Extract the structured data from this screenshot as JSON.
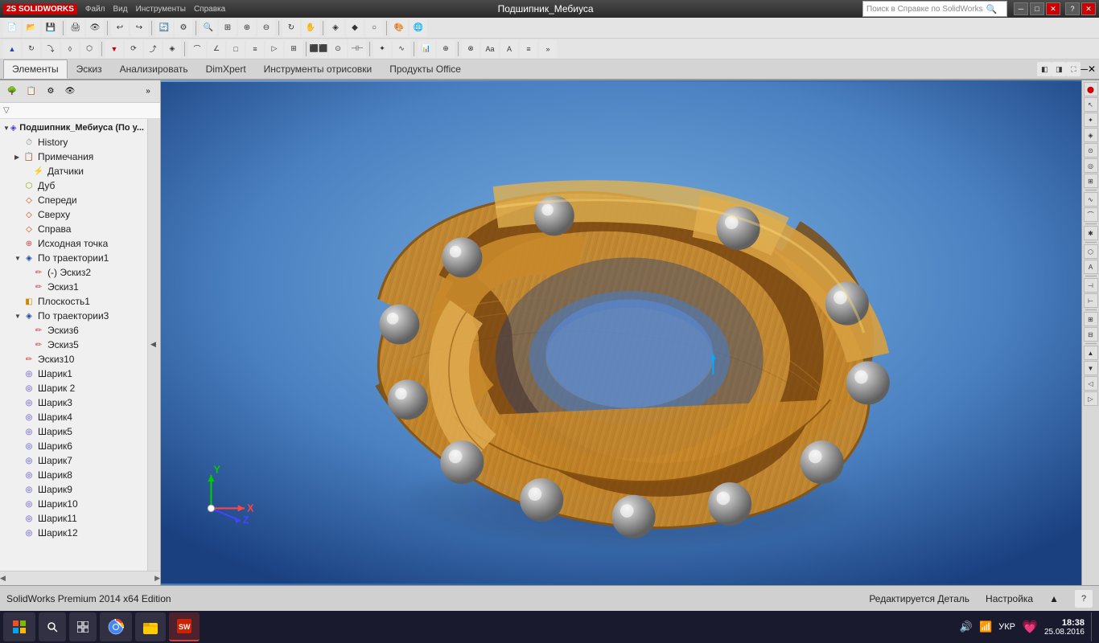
{
  "titlebar": {
    "logo": "2S SOLIDWORKS",
    "title": "Подшипник_Мебиуса",
    "search_placeholder": "Поиск в Справке по SolidWorks",
    "minimize_label": "─",
    "restore_label": "□",
    "close_label": "✕"
  },
  "toolbar1": {
    "buttons": [
      "↩",
      "↪",
      "▶",
      "⬛",
      "🔲",
      "✦",
      "⬛",
      "⬛",
      "⬛",
      "⬛"
    ]
  },
  "menu_tabs": [
    {
      "label": "Элементы",
      "active": true
    },
    {
      "label": "Эскиз",
      "active": false
    },
    {
      "label": "Анализировать",
      "active": false
    },
    {
      "label": "DimXpert",
      "active": false
    },
    {
      "label": "Инструменты отрисовки",
      "active": false
    },
    {
      "label": "Продукты Office",
      "active": false
    }
  ],
  "feature_tree": {
    "root_label": "Подшипник_Мебиуса  (По у...",
    "items": [
      {
        "id": "history",
        "label": "History",
        "indent": 1,
        "expanded": false,
        "icon": "history",
        "has_children": false
      },
      {
        "id": "notes",
        "label": "Примечания",
        "indent": 1,
        "expanded": false,
        "icon": "notes",
        "has_children": true
      },
      {
        "id": "sensors",
        "label": "Датчики",
        "indent": 2,
        "expanded": false,
        "icon": "sensor",
        "has_children": false
      },
      {
        "id": "material",
        "label": "Дуб",
        "indent": 1,
        "expanded": false,
        "icon": "material",
        "has_children": false
      },
      {
        "id": "front",
        "label": "Спереди",
        "indent": 1,
        "expanded": false,
        "icon": "plane",
        "has_children": false
      },
      {
        "id": "top",
        "label": "Сверху",
        "indent": 1,
        "expanded": false,
        "icon": "plane",
        "has_children": false
      },
      {
        "id": "right",
        "label": "Справа",
        "indent": 1,
        "expanded": false,
        "icon": "plane",
        "has_children": false
      },
      {
        "id": "origin",
        "label": "Исходная точка",
        "indent": 1,
        "expanded": false,
        "icon": "origin",
        "has_children": false
      },
      {
        "id": "sweep1",
        "label": "По траектории1",
        "indent": 1,
        "expanded": true,
        "icon": "sweep",
        "has_children": true
      },
      {
        "id": "sketch2",
        "label": "(-) Эскиз2",
        "indent": 2,
        "expanded": false,
        "icon": "sketch",
        "has_children": false
      },
      {
        "id": "sketch1",
        "label": "Эскиз1",
        "indent": 2,
        "expanded": false,
        "icon": "sketch",
        "has_children": false
      },
      {
        "id": "plane1",
        "label": "Плоскость1",
        "indent": 1,
        "expanded": false,
        "icon": "plane",
        "has_children": false
      },
      {
        "id": "sweep3",
        "label": "По траектории3",
        "indent": 1,
        "expanded": true,
        "icon": "sweep",
        "has_children": true
      },
      {
        "id": "sketch6",
        "label": "Эскиз6",
        "indent": 2,
        "expanded": false,
        "icon": "sketch",
        "has_children": false
      },
      {
        "id": "sketch5",
        "label": "Эскиз5",
        "indent": 2,
        "expanded": false,
        "icon": "sketch",
        "has_children": false
      },
      {
        "id": "sketch10",
        "label": "Эскиз10",
        "indent": 1,
        "expanded": false,
        "icon": "sketch",
        "has_children": false
      },
      {
        "id": "ball1",
        "label": "Шарик1",
        "indent": 1,
        "expanded": false,
        "icon": "ball",
        "has_children": false
      },
      {
        "id": "ball2",
        "label": "Шарик 2",
        "indent": 1,
        "expanded": false,
        "icon": "ball",
        "has_children": false
      },
      {
        "id": "ball3",
        "label": "Шарик3",
        "indent": 1,
        "expanded": false,
        "icon": "ball",
        "has_children": false
      },
      {
        "id": "ball4",
        "label": "Шарик4",
        "indent": 1,
        "expanded": false,
        "icon": "ball",
        "has_children": false
      },
      {
        "id": "ball5",
        "label": "Шарик5",
        "indent": 1,
        "expanded": false,
        "icon": "ball",
        "has_children": false
      },
      {
        "id": "ball6",
        "label": "Шарик6",
        "indent": 1,
        "expanded": false,
        "icon": "ball",
        "has_children": false
      },
      {
        "id": "ball7",
        "label": "Шарик7",
        "indent": 1,
        "expanded": false,
        "icon": "ball",
        "has_children": false
      },
      {
        "id": "ball8",
        "label": "Шарик8",
        "indent": 1,
        "expanded": false,
        "icon": "ball",
        "has_children": false
      },
      {
        "id": "ball9",
        "label": "Шарик9",
        "indent": 1,
        "expanded": false,
        "icon": "ball",
        "has_children": false
      },
      {
        "id": "ball10",
        "label": "Шарик10",
        "indent": 1,
        "expanded": false,
        "icon": "ball",
        "has_children": false
      },
      {
        "id": "ball11",
        "label": "Шарик11",
        "indent": 1,
        "expanded": false,
        "icon": "ball",
        "has_children": false
      },
      {
        "id": "ball12",
        "label": "Шарик12",
        "indent": 1,
        "expanded": false,
        "icon": "ball",
        "has_children": false
      }
    ]
  },
  "statusbar": {
    "left_text": "SolidWorks Premium 2014 x64 Edition",
    "center_text": "Редактируется Деталь",
    "right_text": "Настройка",
    "arrow": "▲"
  },
  "taskbar": {
    "start_icon": "⊞",
    "search_icon": "🔍",
    "task_view_icon": "⬜",
    "browser_label": "🌐",
    "explorer_label": "📁",
    "solidworks_label": "SW",
    "time": "18:38",
    "date": "25.08.2016",
    "lang": "УКР",
    "network_icon": "🔊",
    "volume_icon": "🔊"
  },
  "right_toolbar": {
    "buttons": [
      "↑",
      "↓",
      "←",
      "→",
      "⊕",
      "⊗",
      "◈",
      "⊞",
      "⊟",
      "△",
      "▽",
      "◁",
      "▷",
      "✦",
      "★",
      "◆",
      "●",
      "○",
      "□",
      "■",
      "▲",
      "▼",
      "≡",
      "≈",
      "∞",
      "⊂",
      "⊃",
      "∩",
      "∪",
      "⊥"
    ]
  },
  "colors": {
    "background_gradient_start": "#6a9fd8",
    "background_gradient_end": "#1a4080",
    "wood_color": "#c8882a",
    "ball_color": "#999999",
    "titlebar": "#2a2a2a",
    "panel_bg": "#f0f0f0",
    "menu_bg": "#d4d4d4",
    "taskbar_bg": "#1a1a2e"
  }
}
